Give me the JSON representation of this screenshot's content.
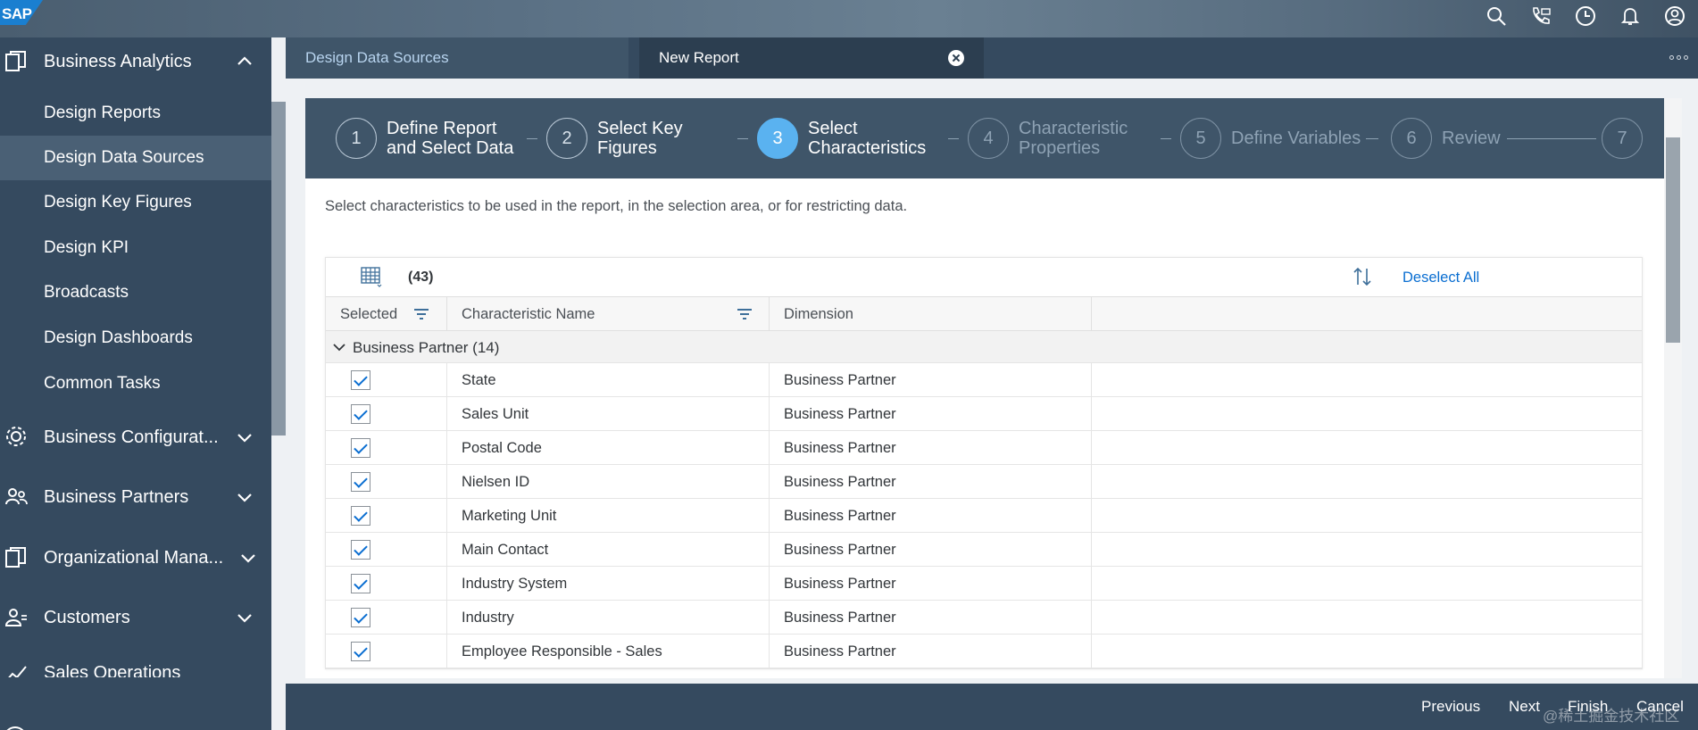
{
  "shell": {
    "logo": "SAP",
    "icons": [
      "search-icon",
      "chat-phone-icon",
      "clock-icon",
      "bell-icon",
      "user-icon"
    ]
  },
  "sidebar": {
    "groups": [
      {
        "label": "Business Analytics",
        "icon": "analytics-icon",
        "expanded": true
      },
      {
        "label": "Business Configurat...",
        "icon": "configuration-icon",
        "expanded": false
      },
      {
        "label": "Business Partners",
        "icon": "partners-icon",
        "expanded": false
      },
      {
        "label": "Organizational Mana...",
        "icon": "organization-icon",
        "expanded": false
      },
      {
        "label": "Customers",
        "icon": "customers-icon",
        "expanded": false
      },
      {
        "label": "Sales Operations",
        "icon": "sales-icon",
        "expanded": false
      }
    ],
    "items": [
      {
        "label": "Design Reports"
      },
      {
        "label": "Design Data Sources",
        "active": true
      },
      {
        "label": "Design Key Figures"
      },
      {
        "label": "Design KPI"
      },
      {
        "label": "Broadcasts"
      },
      {
        "label": "Design Dashboards"
      },
      {
        "label": "Common Tasks"
      }
    ]
  },
  "tabs": [
    {
      "label": "Design Data Sources"
    },
    {
      "label": "New Report",
      "active": true
    }
  ],
  "wizard": {
    "steps": [
      {
        "num": "1",
        "label": [
          "Define Report",
          "and Select Data"
        ],
        "state": "done"
      },
      {
        "num": "2",
        "label": [
          "Select Key",
          "Figures"
        ],
        "state": "done"
      },
      {
        "num": "3",
        "label": [
          "Select",
          "Characteristics"
        ],
        "state": "current"
      },
      {
        "num": "4",
        "label": [
          "Characteristic",
          "Properties"
        ],
        "state": "future"
      },
      {
        "num": "5",
        "label": [
          "Define Variables"
        ],
        "state": "future"
      },
      {
        "num": "6",
        "label": [
          "Review"
        ],
        "state": "future"
      },
      {
        "num": "7",
        "label": [],
        "state": "future"
      }
    ]
  },
  "instruction": "Select characteristics to be used in the report, in the selection area, or for restricting data.",
  "table": {
    "count": "(43)",
    "deselect_all": "Deselect All",
    "columns": [
      "Selected",
      "Characteristic Name",
      "Dimension"
    ],
    "group": "Business Partner (14)",
    "rows": [
      {
        "selected": true,
        "name": "State",
        "dimension": "Business Partner"
      },
      {
        "selected": true,
        "name": "Sales Unit",
        "dimension": "Business Partner"
      },
      {
        "selected": true,
        "name": "Postal Code",
        "dimension": "Business Partner"
      },
      {
        "selected": true,
        "name": "Nielsen ID",
        "dimension": "Business Partner"
      },
      {
        "selected": true,
        "name": "Marketing Unit",
        "dimension": "Business Partner"
      },
      {
        "selected": true,
        "name": "Main Contact",
        "dimension": "Business Partner"
      },
      {
        "selected": true,
        "name": "Industry System",
        "dimension": "Business Partner"
      },
      {
        "selected": true,
        "name": "Industry",
        "dimension": "Business Partner"
      },
      {
        "selected": true,
        "name": "Employee Responsible - Sales",
        "dimension": "Business Partner"
      }
    ]
  },
  "footer": {
    "previous": "Previous",
    "next": "Next",
    "finish": "Finish",
    "cancel": "Cancel",
    "watermark": "@稀土掘金技术社区"
  },
  "colors": {
    "shell": "#354a5f",
    "accent": "#0a6ed1",
    "step_current": "#5ab2f0"
  }
}
